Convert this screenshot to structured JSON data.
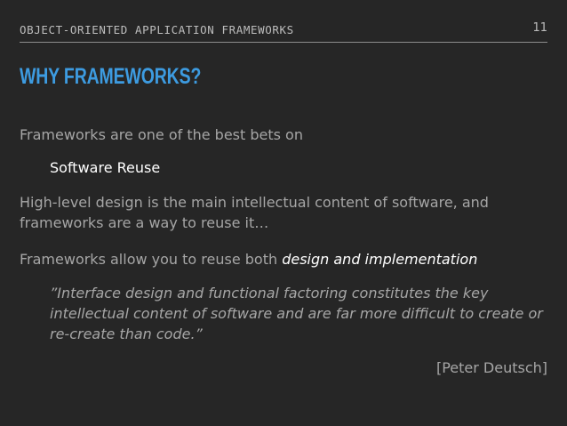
{
  "header": {
    "title": "OBJECT-ORIENTED APPLICATION FRAMEWORKS",
    "page_number": "11"
  },
  "slide": {
    "title": "WHY FRAMEWORKS?",
    "para1": "Frameworks are one of the best bets on",
    "para2": "Software Reuse",
    "para3_line1": "High-level design is the main intellectual content of software, and",
    "para3_line2": "frameworks are a way to reuse it…",
    "para4_prefix": "Frameworks allow you to reuse both ",
    "para4_emphasis": "design and implementation",
    "quote_line1": "”Interface design and functional factoring constitutes the key",
    "quote_line2": "intellectual content of software and are far more difficult to create or",
    "quote_line3": "re-create than code.”",
    "attribution": "[Peter Deutsch]"
  },
  "colors": {
    "background": "#262626",
    "title": "#3d9be0",
    "body_text": "#a6a6a6",
    "highlight_text": "#ffffff"
  }
}
